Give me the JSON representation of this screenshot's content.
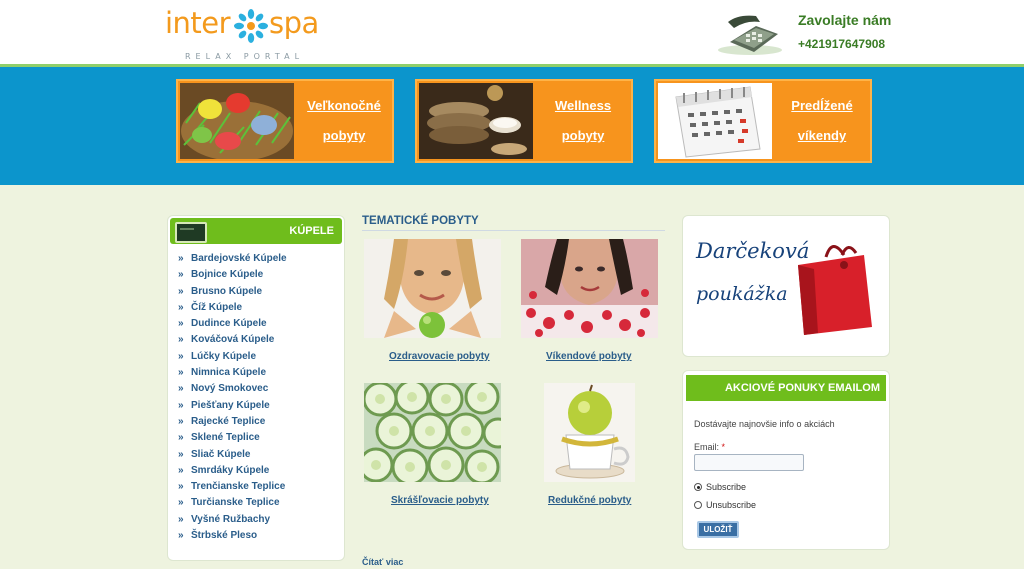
{
  "header": {
    "logo_left": "inter",
    "logo_right": "spa",
    "logo_tagline": "RELAX PORTAL",
    "contact_title": "Zavolajte nám",
    "contact_phone": "+421917647908"
  },
  "banners": [
    {
      "line1": "Veľkonočné",
      "line2": "pobyty",
      "icon": "easter-eggs-photo"
    },
    {
      "line1": "Wellness",
      "line2": "pobyty",
      "icon": "wellness-towels-photo"
    },
    {
      "line1": "Predĺžené",
      "line2": "víkendy",
      "icon": "calendar-photo"
    }
  ],
  "sidebar": {
    "title": "KÚPELE",
    "items": [
      "Bardejovské Kúpele",
      "Bojnice Kúpele",
      "Brusno Kúpele",
      "Číž Kúpele",
      "Dudince Kúpele",
      "Kováčová Kúpele",
      "Lúčky Kúpele",
      "Nimnica Kúpele",
      "Nový Smokovec",
      "Piešťany Kúpele",
      "Rajecké Teplice",
      "Sklené Teplice",
      "Sliač Kúpele",
      "Smrdáky Kúpele",
      "Trenčianske Teplice",
      "Turčianske Teplice",
      "Vyšné Ružbachy",
      "Štrbské Pleso"
    ]
  },
  "thematic": {
    "title": "TEMATICKÉ POBYTY",
    "items": [
      {
        "label": "Ozdravovacie pobyty",
        "icon": "woman-apple-photo"
      },
      {
        "label": "Víkendové pobyty",
        "icon": "woman-rose-bath-photo"
      },
      {
        "label": "Skrášľovacie pobyty",
        "icon": "cucumber-slices-photo"
      },
      {
        "label": "Redukčné pobyty",
        "icon": "apple-measuring-tape-photo"
      }
    ],
    "more": "Čítať viac"
  },
  "gift": {
    "line1": "Darčeková",
    "line2": "poukážka"
  },
  "newsletter": {
    "title": "AKCIOVÉ PONUKY EMAILOM",
    "info": "Dostávajte najnovšie info o akciách",
    "email_label": "Email:",
    "required_mark": "*",
    "email_value": "",
    "subscribe_label": "Subscribe",
    "unsubscribe_label": "Unsubscribe",
    "selected": "subscribe",
    "save_label": "ULOŽIŤ"
  },
  "colors": {
    "brand_orange": "#f7941d",
    "banner_blue": "#0c95cc",
    "green_header": "#6fbd1c",
    "link_blue": "#2a5d8a",
    "contact_green": "#3a7c25"
  }
}
